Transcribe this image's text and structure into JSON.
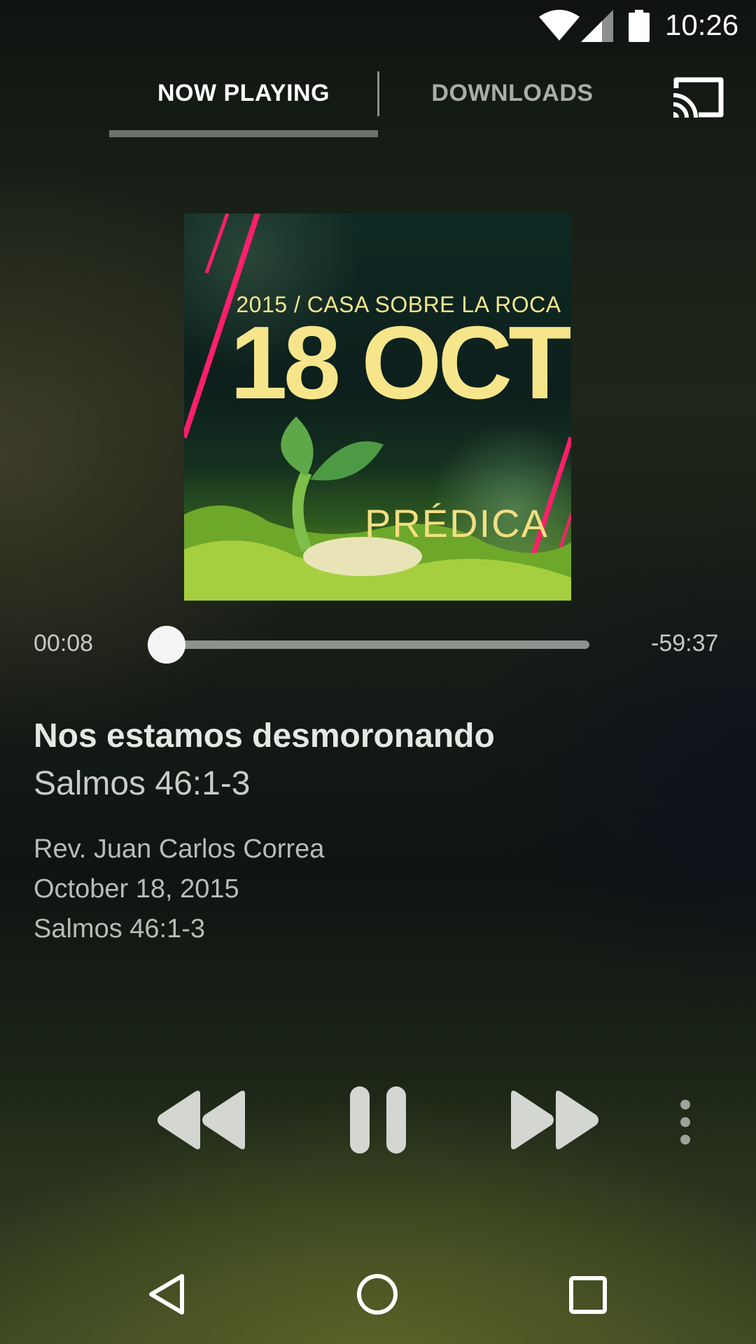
{
  "status_bar": {
    "time": "10:26",
    "icons": [
      "wifi-icon",
      "cell-signal-icon",
      "battery-icon"
    ]
  },
  "tabs": [
    {
      "label": "NOW PLAYING",
      "selected": true
    },
    {
      "label": "DOWNLOADS",
      "selected": false
    }
  ],
  "cast": {
    "icon": "cast-icon"
  },
  "album_art": {
    "subtitle": "2015 / CASA SOBRE LA ROCA",
    "date": "18 OCT",
    "label": "PRÉDICA"
  },
  "player": {
    "elapsed": "00:08",
    "remaining": "-59:37",
    "progress_fraction": 0.002
  },
  "track": {
    "title": "Nos estamos desmoronando",
    "subtitle": "Salmos 46:1-3",
    "speaker": "Rev. Juan Carlos Correa",
    "date": "October 18, 2015",
    "reference": "Salmos 46:1-3"
  },
  "controls": {
    "icons": [
      "rewind-icon",
      "pause-icon",
      "fast-forward-icon",
      "more-vert-icon"
    ]
  },
  "nav_bar": {
    "icons": [
      "back-icon",
      "home-icon",
      "recent-apps-icon"
    ]
  },
  "colors": {
    "accent_line": "#ff1f6b",
    "art_text": "#f6e58a"
  }
}
